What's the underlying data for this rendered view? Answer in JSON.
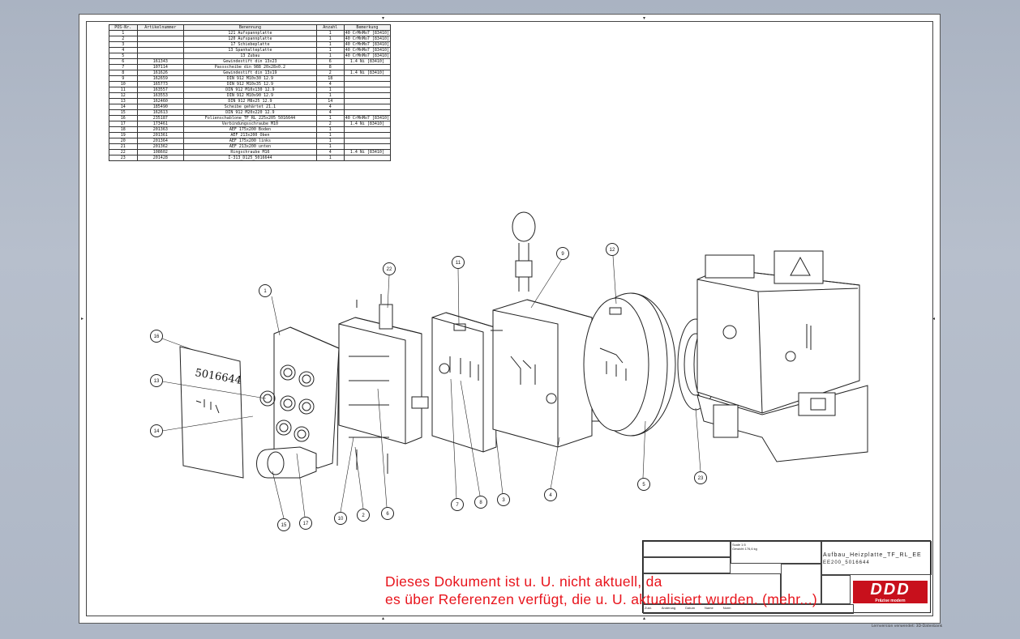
{
  "bom": {
    "headers": [
      "POS-Nr.",
      "Artikelnummer",
      "Benennung",
      "Anzahl",
      "Bemerkung"
    ],
    "rows": [
      [
        "1",
        "",
        "121 Aufspannplatte",
        "1",
        "40 CrMnMo7 [83410]"
      ],
      [
        "2",
        "",
        "120 Aufspannplatte",
        "1",
        "40 CrMnMo7 [83410]"
      ],
      [
        "3",
        "",
        "17 Schiebeplatte",
        "1",
        "40 CrMnMo7 [83410]"
      ],
      [
        "4",
        "",
        "13 Spanhalteplatte",
        "1",
        "40 CrMnMo7 [83410]"
      ],
      [
        "5",
        "",
        "13 Zubau",
        "1",
        "40 CrMnMo7 [83410]"
      ],
      [
        "6",
        "161343",
        "Gewindestift din 13x23",
        "6",
        "1.4 Ni [83410]"
      ],
      [
        "7",
        "107114",
        "Passscheibe din 988 20x28x0.2",
        "8",
        ""
      ],
      [
        "8",
        "161626",
        "Gewindestift din 13x19",
        "2",
        "1.4 Ni [83410]"
      ],
      [
        "9",
        "162659",
        "DIN 912 M10x30 12.9",
        "18",
        ""
      ],
      [
        "10",
        "165773",
        "DIN 912 M10x35 12.9",
        "4",
        ""
      ],
      [
        "11",
        "163557",
        "DIN 912 M10x130 12.9",
        "1",
        ""
      ],
      [
        "12",
        "163553",
        "DIN 912 M10x90 12.9",
        "1",
        ""
      ],
      [
        "13",
        "162460",
        "DIN 912 M8x25 12.9",
        "14",
        ""
      ],
      [
        "14",
        "185490",
        "Scheibe gehärtet 21.1",
        "4",
        ""
      ],
      [
        "15",
        "162613",
        "DIN 912 M20x220 12.9",
        "4",
        ""
      ],
      [
        "16",
        "235187",
        "Folienschablone_TF_RL_225x205_5016644",
        "1",
        "40 CrMnMo7 [83410]"
      ],
      [
        "17",
        "173461",
        "Verbindungsschraube M10",
        "2",
        "1.4 Ni [83410]"
      ],
      [
        "18",
        "201363",
        "AEF 175x200 Boden",
        "1",
        ""
      ],
      [
        "19",
        "201361",
        "AEF 213x200 Oben",
        "1",
        ""
      ],
      [
        "20",
        "201364",
        "AEF 175x200 links",
        "1",
        ""
      ],
      [
        "21",
        "201362",
        "AEF 213x200 unten",
        "1",
        ""
      ],
      [
        "22",
        "108602",
        "Ringschraube M16",
        "4",
        "1.4 Ni [83410]"
      ],
      [
        "23",
        "201428",
        "I-313_D125_5016644",
        "1",
        ""
      ]
    ]
  },
  "label_card_text": "5016644",
  "balloons": [
    {
      "n": "1"
    },
    {
      "n": "2"
    },
    {
      "n": "3"
    },
    {
      "n": "4"
    },
    {
      "n": "5"
    },
    {
      "n": "6"
    },
    {
      "n": "7"
    },
    {
      "n": "8"
    },
    {
      "n": "9"
    },
    {
      "n": "10"
    },
    {
      "n": "11"
    },
    {
      "n": "12"
    },
    {
      "n": "13"
    },
    {
      "n": "14"
    },
    {
      "n": "15"
    },
    {
      "n": "16"
    },
    {
      "n": "17"
    },
    {
      "n": "22"
    },
    {
      "n": "23"
    }
  ],
  "titleblock": {
    "drawing_name": "Aufbau_Heizplatte_TF_RL_EE",
    "drawing_number": "EE200_5016644",
    "scale": "Scale 1:5",
    "weight": "Gewicht 176,6 kg",
    "row_labels": [
      "Zust.",
      "Änderung",
      "Datum",
      "Name",
      "Norm"
    ],
    "logo_text": "DDD",
    "logo_sub": "Präzise modern"
  },
  "warning": {
    "line1": "Dieses Dokument ist u. U. nicht aktuell, da",
    "line2": "es über Referenzen verfügt, die u. U. aktualisiert wurden. (mehr...)"
  },
  "footer_note": "Lernversion verwendet: 3D-Datenbank"
}
